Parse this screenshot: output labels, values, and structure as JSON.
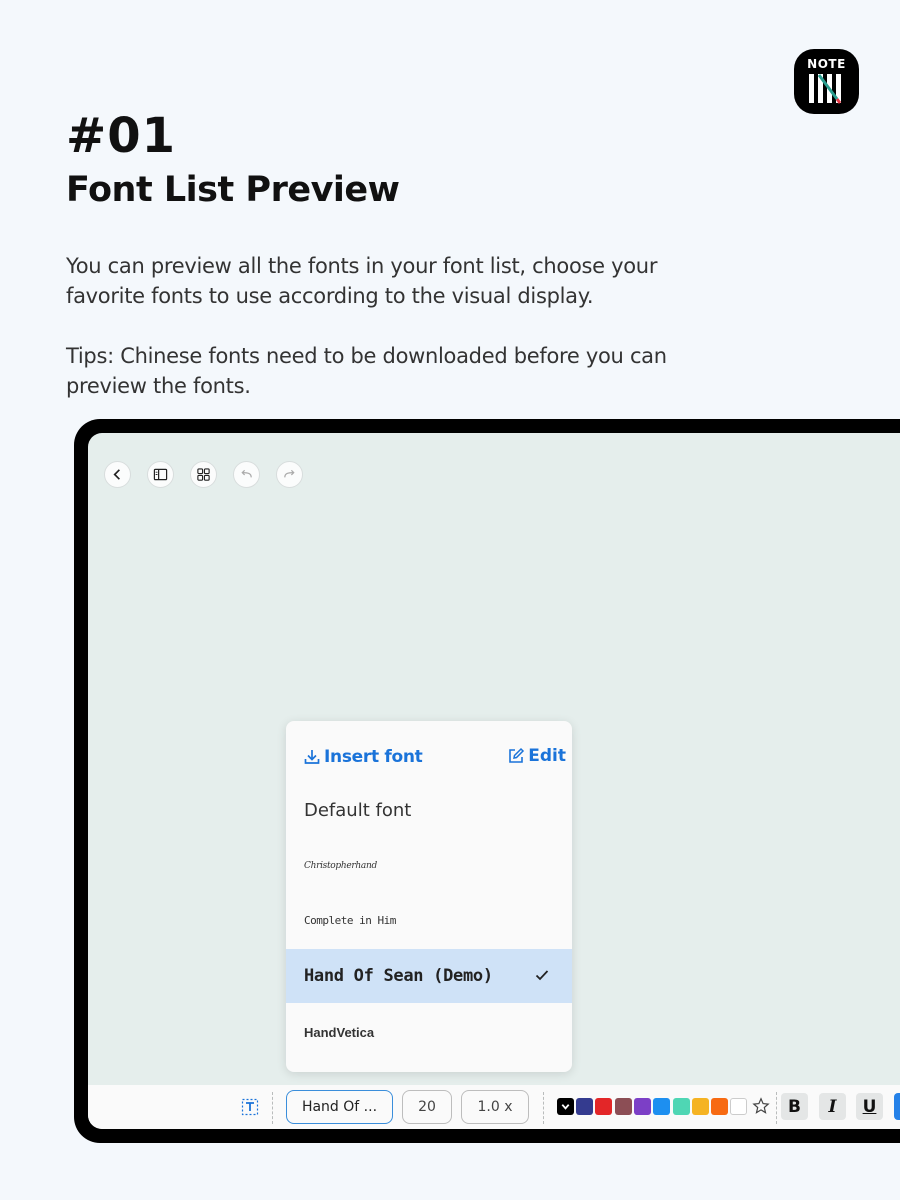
{
  "logo": {
    "text": "NOTE"
  },
  "heading": {
    "number": "#01",
    "title": "Font List Preview"
  },
  "description": {
    "line1": "You can preview all the fonts in your font list, choose your favorite fonts to use according to the visual display.",
    "line2": "Tips: Chinese fonts need to be downloaded before you can preview the fonts."
  },
  "font_popup": {
    "insert_label": "Insert font",
    "edit_label": "Edit",
    "fonts": [
      {
        "label": "Default font",
        "selected": false
      },
      {
        "label": "Christopherhand",
        "selected": false
      },
      {
        "label": "Complete in Him",
        "selected": false
      },
      {
        "label": "Hand Of Sean (Demo)",
        "selected": true
      },
      {
        "label": "HandVetica",
        "selected": false
      }
    ]
  },
  "toolbar": {
    "font_value": "Hand Of ...",
    "size_value": "20",
    "spacing_value": "1.0 x",
    "colors": [
      "#343b8f",
      "#e32628",
      "#8c4e55",
      "#7c3fc6",
      "#1d8ff0",
      "#4fd6b4",
      "#f5b323",
      "#f76a12",
      "#ffffff"
    ],
    "bold_label": "B",
    "italic_label": "I",
    "underline_label": "U"
  },
  "accent_color": "#1a73d9"
}
